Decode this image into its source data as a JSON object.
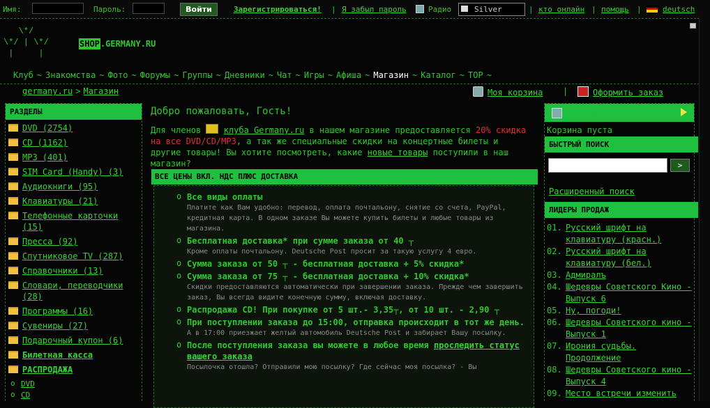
{
  "topbar": {
    "name_label": "Имя:",
    "password_label": "Пароль:",
    "login_button": "Войти",
    "register_link": "Зарегистрироваться!",
    "forgot_link": "Я забыл пароль",
    "radio_label": "Радио",
    "radio_value": "Silver",
    "who_online": "кто онлайн",
    "help": "помощь",
    "lang": "deutsch",
    "sep": "|"
  },
  "header": {
    "logo_art": "   \\*/\n\\*/ | \\*/\n |     |",
    "shop_box": "SHOP",
    "shop_rest": ".GERMANY.RU"
  },
  "nav": {
    "items": [
      "Клуб",
      "Знакомства",
      "Фото",
      "Форумы",
      "Группы",
      "Дневники",
      "Чат",
      "Игры",
      "Афиша",
      "Магазин",
      "Каталог",
      "TOP"
    ],
    "separator": "~",
    "active": "Магазин"
  },
  "breadcrumb": {
    "home": "germany.ru",
    "sep": ">",
    "current": "Магазин"
  },
  "actions": {
    "cart": "Моя корзина",
    "sep": "|",
    "order": "Оформить заказ"
  },
  "sidebar": {
    "title": "РАЗДЕЛЫ",
    "categories": [
      {
        "label": "DVD (2754)"
      },
      {
        "label": "CD (1162)"
      },
      {
        "label": "MP3 (401)"
      },
      {
        "label": "SIM Card (Handy) (3)"
      },
      {
        "label": "Аудиокниги (95)"
      },
      {
        "label": "Клавиатуры (21)"
      },
      {
        "label": "Телефонные карточки (15)"
      },
      {
        "label": "Пресса (92)"
      },
      {
        "label": "Спутниковое TV (287)"
      },
      {
        "label": "Справочники (13)"
      },
      {
        "label": "Словари, переводчики (28)"
      },
      {
        "label": "Программы (16)"
      },
      {
        "label": "Сувениры (27)"
      },
      {
        "label": "Подарочный купон (6)"
      },
      {
        "label": "Билетная касса"
      },
      {
        "label": "РАСПРОДАЖА"
      }
    ],
    "sale_items": [
      "DVD",
      "CD"
    ]
  },
  "main": {
    "welcome": "Добро пожаловать, Гость!",
    "intro_1": "Для членов",
    "intro_club": "клуба Germany.ru",
    "intro_2": "в нашем магазине предоставляется",
    "intro_red": "20% скидка на все DVD/CD/MP3",
    "intro_3": ", а так же специальные скидки на концертные билеты и другие товары! Вы хотите посмотреть, какие",
    "intro_new": "новые товары",
    "intro_4": "поступили в наш магазин?",
    "prices_title": "ВСЕ ЦЕНЫ ВКЛ. НДС ПЛЮС ДОСТАВКА",
    "prices": [
      {
        "title": "Все виды оплаты",
        "desc": "Платите как Вам удобно: перевод, оплата почтальону, снятие со счета, PayPal, кредитная карта. В одном заказе Вы можете купить билеты и любые товары из магазина."
      },
      {
        "title": "Бесплатная доставка* при сумме заказа от 40 ┬",
        "desc": "Кроме оплаты почтальону. Deutsche Post просит за такую услугу 4 евро."
      },
      {
        "title": "Сумма заказа от 50 ┬ - бесплатная доставка + 5% скидка*",
        "desc": ""
      },
      {
        "title": "Сумма заказа от 75 ┬ - бесплатная доставка + 10% скидка*",
        "desc": "Скидки предоставляются автоматически при завершении заказа. Прежде чем завершить заказ, Вы всегда видите конечную сумму, включая доставку."
      },
      {
        "title": "Распродажа CD! При покупке от 5 шт.- 3,35┬, от 10 шт. - 2,90 ┬",
        "desc": ""
      },
      {
        "title": "При поступлении заказа до 15:00, отправка происходит в тот же день.",
        "desc": "А в 17:00 приезжает желтый автомобиль Deutsche Post и забирает Вашу посылку."
      },
      {
        "title": "После поступления заказа вы можете в любое время",
        "link": "проследить статус вашего заказа",
        "desc": "Посылочка отошла? Отправили мою посылку? Где сейчас моя посылка? - Вы"
      }
    ]
  },
  "right": {
    "cart_title": "Моя корзина",
    "cart_empty": "Корзина пуста",
    "quick_search_title": "БЫСТРЫЙ ПОИСК",
    "search_button": ">",
    "advanced_search": "Расширенный поиск",
    "leaders_title": "ЛИДЕРЫ ПРОДАЖ",
    "leaders": [
      {
        "n": "01.",
        "label": "Русский шрифт на клавиатуру (красн.)"
      },
      {
        "n": "02.",
        "label": "Русский шрифт на клавиатуру (бел.)"
      },
      {
        "n": "03.",
        "label": "Адмиралъ"
      },
      {
        "n": "04.",
        "label": "Шедевры Советского Кино - Выпуск 6"
      },
      {
        "n": "05.",
        "label": "Ну, погоди!"
      },
      {
        "n": "06.",
        "label": "Шедевры Советского кино - Выпуск 1"
      },
      {
        "n": "07.",
        "label": "Ирония судьбы. Продолжение"
      },
      {
        "n": "08.",
        "label": "Шедевры Советского кино - Выпуск 4"
      },
      {
        "n": "09.",
        "label": "Место встречи изменить"
      }
    ]
  }
}
